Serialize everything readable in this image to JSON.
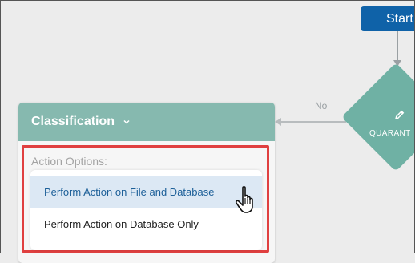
{
  "workflow": {
    "start_label": "Start",
    "decision_label": "QUARANT",
    "edge_no_label": "No"
  },
  "classification": {
    "title": "Classification",
    "action_options_label": "Action Options:",
    "options": [
      {
        "label": "Perform Action on File and Database",
        "selected": true
      },
      {
        "label": "Perform Action on Database Only",
        "selected": false
      }
    ]
  },
  "colors": {
    "start_node": "#0f62a8",
    "decision_node": "#6fb1a4",
    "card_header": "#86b9af",
    "highlight_border": "#e04040",
    "selected_option_bg": "#dce8f4",
    "selected_option_text": "#1c5f98"
  },
  "icons": {
    "decision": "pencil-icon",
    "dropdown": "chevron-down-icon",
    "cursor": "hand-cursor-icon"
  }
}
